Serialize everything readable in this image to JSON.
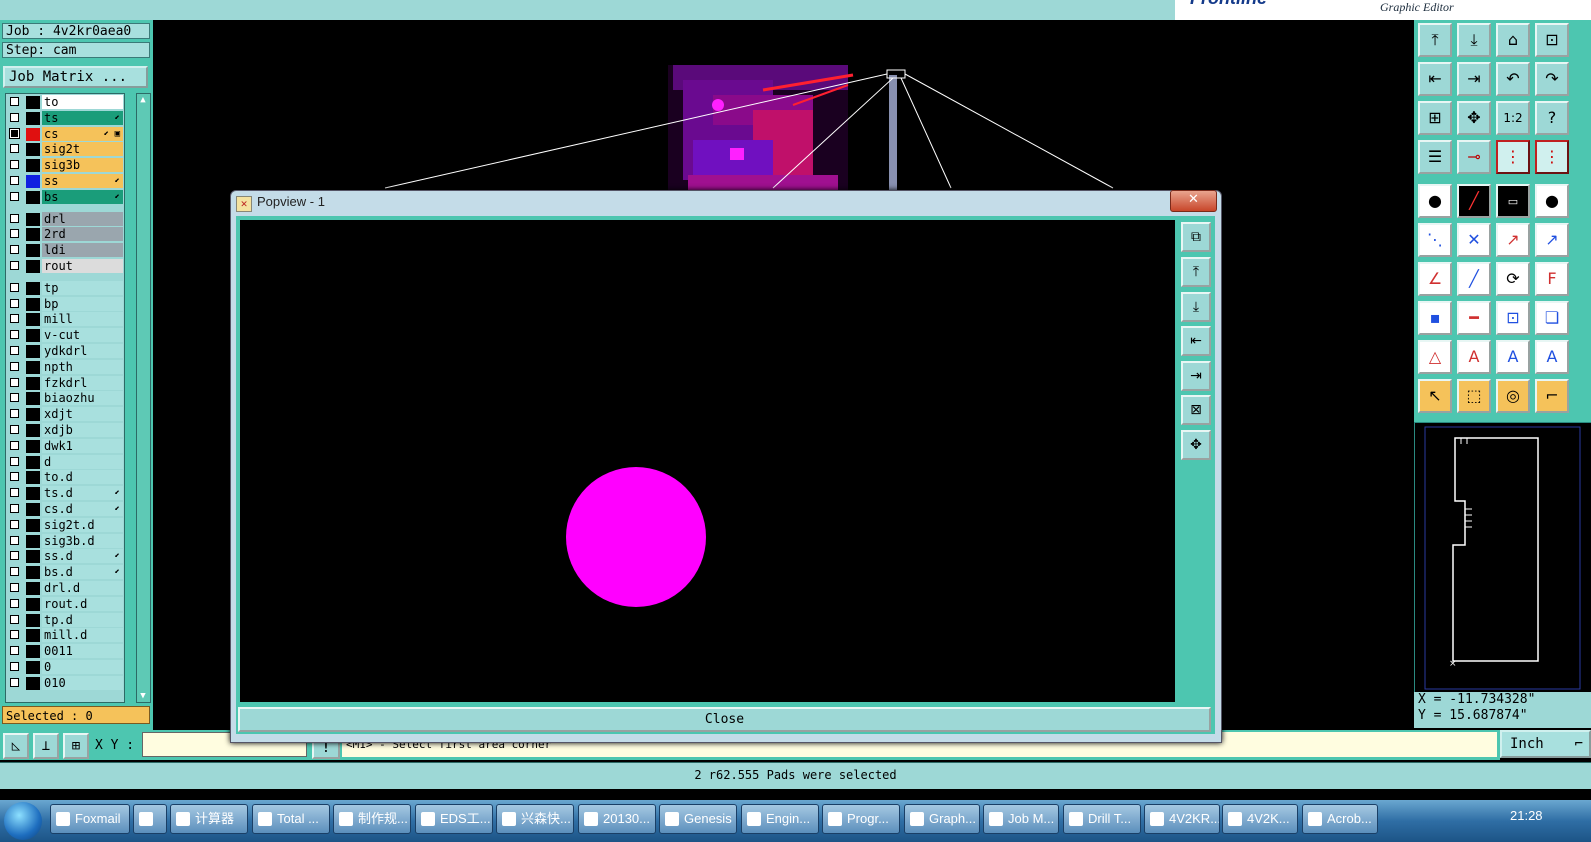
{
  "app": {
    "title_brand": "Graphic Editor",
    "job": "Job : 4v2kr0aea0",
    "step": "Step: cam",
    "job_matrix_button": "Job Matrix ...",
    "selected": "Selected : 0"
  },
  "layers": [
    {
      "name": "to",
      "color": "#ffffff",
      "bg": "#ffffff",
      "mark": "",
      "color_chip": ""
    },
    {
      "name": "ts",
      "color": "#1a9d7a",
      "bg": "#1a9d7a",
      "mark": "⬋",
      "color_chip": ""
    },
    {
      "name": "cs",
      "color": "#f5c25a",
      "bg": "#f5c25a",
      "mark": "⬋ ▣",
      "color_chip": "#e01010",
      "selected": true
    },
    {
      "name": "sig2t",
      "color": "#f5c25a",
      "bg": "#f5c25a",
      "mark": "",
      "color_chip": ""
    },
    {
      "name": "sig3b",
      "color": "#f5c25a",
      "bg": "#f5c25a",
      "mark": "",
      "color_chip": ""
    },
    {
      "name": "ss",
      "color": "#f5c25a",
      "bg": "#f5c25a",
      "mark": "⬋",
      "color_chip": "#1020e0"
    },
    {
      "name": "bs",
      "color": "#1a9d7a",
      "bg": "#1a9d7a",
      "mark": "⬋",
      "color_chip": ""
    },
    {
      "name": "drl",
      "color": "#9aa6ae",
      "bg": "#9aa6ae",
      "mark": "",
      "color_chip": ""
    },
    {
      "name": "2rd",
      "color": "#9aa6ae",
      "bg": "#9aa6ae",
      "mark": "",
      "color_chip": ""
    },
    {
      "name": "ldi",
      "color": "#9aa6ae",
      "bg": "#9aa6ae",
      "mark": "",
      "color_chip": ""
    },
    {
      "name": "rout",
      "color": "#dcdcdc",
      "bg": "#dcdcdc",
      "mark": "",
      "color_chip": ""
    },
    {
      "name": "tp",
      "bg": "#a8e0de",
      "mark": "",
      "color_chip": ""
    },
    {
      "name": "bp",
      "bg": "#a8e0de",
      "mark": "",
      "color_chip": ""
    },
    {
      "name": "mill",
      "bg": "#a8e0de",
      "mark": "",
      "color_chip": ""
    },
    {
      "name": "v-cut",
      "bg": "#a8e0de",
      "mark": "",
      "color_chip": ""
    },
    {
      "name": "ydkdrl",
      "bg": "#a8e0de",
      "mark": "",
      "color_chip": ""
    },
    {
      "name": "npth",
      "bg": "#a8e0de",
      "mark": "",
      "color_chip": ""
    },
    {
      "name": "fzkdrl",
      "bg": "#a8e0de",
      "mark": "",
      "color_chip": ""
    },
    {
      "name": "biaozhu",
      "bg": "#a8e0de",
      "mark": "",
      "color_chip": ""
    },
    {
      "name": "xdjt",
      "bg": "#a8e0de",
      "mark": "",
      "color_chip": ""
    },
    {
      "name": "xdjb",
      "bg": "#a8e0de",
      "mark": "",
      "color_chip": ""
    },
    {
      "name": "dwk1",
      "bg": "#a8e0de",
      "mark": "",
      "color_chip": ""
    },
    {
      "name": "d",
      "bg": "#a8e0de",
      "mark": "",
      "color_chip": ""
    },
    {
      "name": "to.d",
      "bg": "#a8e0de",
      "mark": "",
      "color_chip": ""
    },
    {
      "name": "ts.d",
      "bg": "#a8e0de",
      "mark": "⬋",
      "color_chip": ""
    },
    {
      "name": "cs.d",
      "bg": "#a8e0de",
      "mark": "⬋",
      "color_chip": ""
    },
    {
      "name": "sig2t.d",
      "bg": "#a8e0de",
      "mark": "",
      "color_chip": ""
    },
    {
      "name": "sig3b.d",
      "bg": "#a8e0de",
      "mark": "",
      "color_chip": ""
    },
    {
      "name": "ss.d",
      "bg": "#a8e0de",
      "mark": "⬋",
      "color_chip": ""
    },
    {
      "name": "bs.d",
      "bg": "#a8e0de",
      "mark": "⬋",
      "color_chip": ""
    },
    {
      "name": "drl.d",
      "bg": "#a8e0de",
      "mark": "",
      "color_chip": ""
    },
    {
      "name": "rout.d",
      "bg": "#a8e0de",
      "mark": "",
      "color_chip": ""
    },
    {
      "name": "tp.d",
      "bg": "#a8e0de",
      "mark": "",
      "color_chip": ""
    },
    {
      "name": "mill.d",
      "bg": "#a8e0de",
      "mark": "",
      "color_chip": ""
    },
    {
      "name": "0011",
      "bg": "#a8e0de",
      "mark": "",
      "color_chip": ""
    },
    {
      "name": "0",
      "bg": "#a8e0de",
      "mark": "",
      "color_chip": ""
    },
    {
      "name": "010",
      "bg": "#a8e0de",
      "mark": "",
      "color_chip": ""
    }
  ],
  "popview": {
    "title": "Popview - 1",
    "close_label": "Close",
    "close_x": "✕",
    "pad_color": "#ff00ff"
  },
  "coords": {
    "x": "X = -11.734328\"",
    "y": "Y = 15.687874\""
  },
  "units": "Inch",
  "xy_label": "X Y :",
  "prompt_message": "<M1> - Select first area corner",
  "status_message": "2 r62.555 Pads were selected",
  "taskbar": {
    "items": [
      "Foxmail",
      "",
      "计算器",
      "Total ...",
      "制作规...",
      "EDS工...",
      "兴森快...",
      "20130...",
      "Genesis",
      "Engin...",
      "Progr...",
      "Graph...",
      "Job M...",
      "Drill T...",
      "4V2KR...",
      "4V2K...",
      "Acrob..."
    ],
    "clock": "21:28"
  }
}
